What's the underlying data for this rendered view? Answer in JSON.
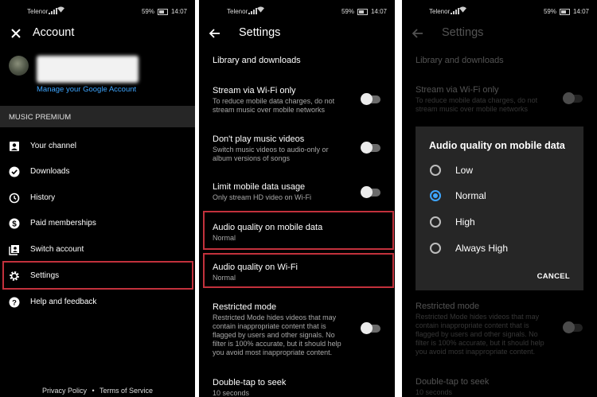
{
  "status_bar": {
    "carrier": "Telenor",
    "battery": "59%",
    "time": "14:07"
  },
  "screen1": {
    "title": "Account",
    "manage_link": "Manage your Google Account",
    "section_header": "MUSIC PREMIUM",
    "menu": [
      {
        "label": "Your channel",
        "icon": "account-box-icon"
      },
      {
        "label": "Downloads",
        "icon": "download-check-icon"
      },
      {
        "label": "History",
        "icon": "history-icon"
      },
      {
        "label": "Paid memberships",
        "icon": "dollar-icon"
      },
      {
        "label": "Switch account",
        "icon": "switch-account-icon"
      },
      {
        "label": "Settings",
        "icon": "gear-icon"
      },
      {
        "label": "Help and feedback",
        "icon": "help-icon"
      }
    ],
    "footer": {
      "privacy": "Privacy Policy",
      "separator": "•",
      "terms": "Terms of Service"
    }
  },
  "screen2": {
    "title": "Settings",
    "library": "Library and downloads",
    "stream_wifi": {
      "title": "Stream via Wi-Fi only",
      "sub1": "To reduce mobile data charges, do not",
      "sub2": "stream music over mobile networks"
    },
    "no_videos": {
      "title": "Don't play music videos",
      "sub1": "Switch music videos to audio-only or",
      "sub2": "album versions of songs"
    },
    "limit_data": {
      "title": "Limit mobile data usage",
      "sub1": "Only stream HD video on Wi-Fi"
    },
    "audio_mobile": {
      "title": "Audio quality on mobile data",
      "value": "Normal"
    },
    "audio_wifi": {
      "title": "Audio quality on Wi-Fi",
      "value": "Normal"
    },
    "restricted": {
      "title": "Restricted mode",
      "lines": [
        "Restricted Mode hides videos that may",
        "contain inappropriate content that is",
        "flagged by users and other signals. No",
        "filter is 100% accurate, but it should help",
        "you avoid most inappropriate content."
      ]
    },
    "double_tap": {
      "title": "Double-tap to seek",
      "value": "10 seconds"
    }
  },
  "screen3": {
    "dialog": {
      "title": "Audio quality on mobile data",
      "options": [
        "Low",
        "Normal",
        "High",
        "Always High"
      ],
      "selected_index": 1,
      "cancel": "CANCEL"
    }
  },
  "colors": {
    "accent": "#3ea6ff",
    "highlight": "#c2313c",
    "dialog_bg": "#262626"
  }
}
